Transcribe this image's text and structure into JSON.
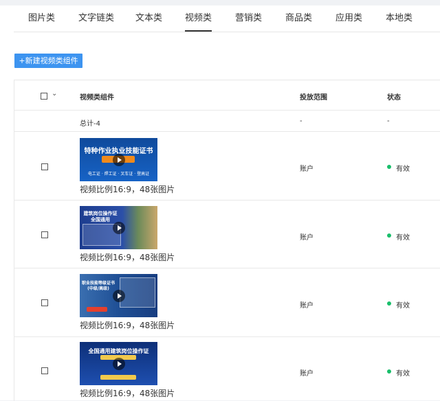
{
  "tabs": [
    "图片类",
    "文字链类",
    "文本类",
    "视频类",
    "营销类",
    "商品类",
    "应用类",
    "本地类"
  ],
  "active_tab": "视频类",
  "add_button": "+新建视频类组件",
  "table": {
    "headers": {
      "component": "视频类组件",
      "scope": "投放范围",
      "status": "状态"
    },
    "summary": {
      "label": "总计-4",
      "scope": "-",
      "status": "-"
    },
    "rows": [
      {
        "thumb_title": "特种作业执业技能证书",
        "thumb_sub": "电工证 · 焊工证 · 叉车证 · 登高证",
        "description": "视频比例16:9，48张图片",
        "scope": "账户",
        "status": "有效"
      },
      {
        "thumb_title": "建筑岗位操作证",
        "thumb_sub": "全国通用",
        "description": "视频比例16:9，48张图片",
        "scope": "账户",
        "status": "有效"
      },
      {
        "thumb_title": "职业技能等级证书",
        "thumb_sub": "(中级/高级)",
        "description": "视频比例16:9，48张图片",
        "scope": "账户",
        "status": "有效"
      },
      {
        "thumb_title": "全国通用建筑岗位操作证",
        "thumb_sub": "",
        "description": "视频比例16:9，48张图片",
        "scope": "账户",
        "status": "有效"
      }
    ]
  },
  "colors": {
    "accent": "#3d94f0",
    "valid": "#19be6b"
  }
}
